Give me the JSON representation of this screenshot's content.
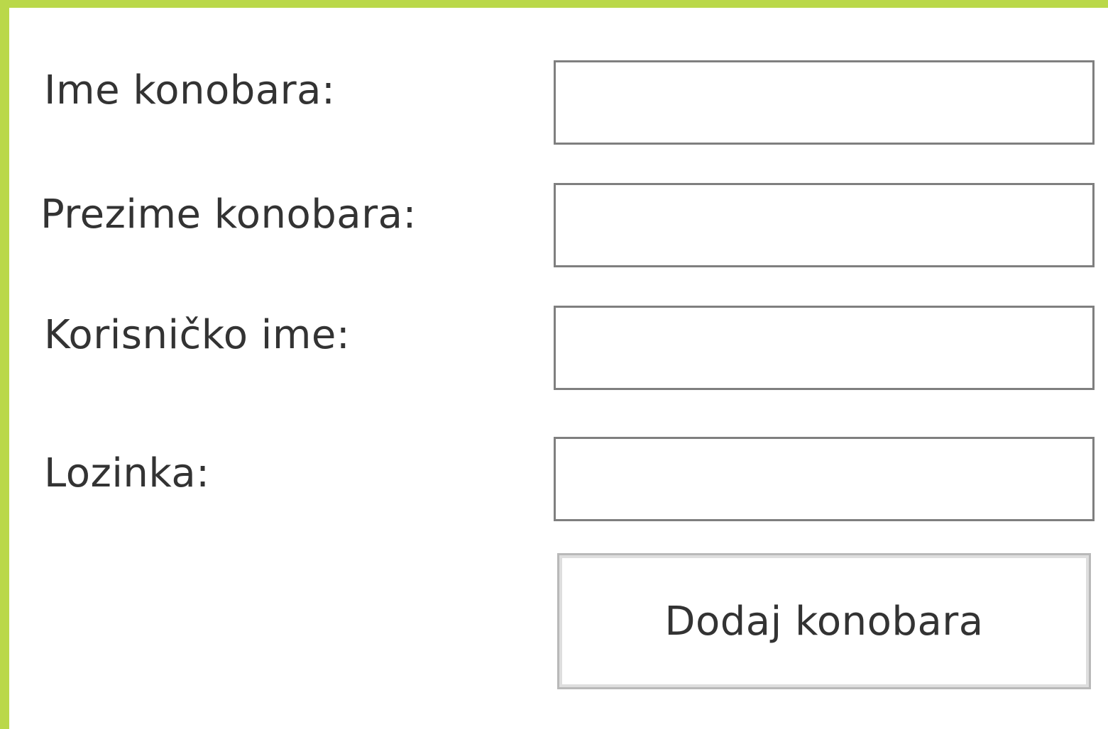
{
  "form": {
    "first_name": {
      "label": "Ime konobara:",
      "value": ""
    },
    "last_name": {
      "label": "Prezime konobara:",
      "value": ""
    },
    "username": {
      "label": "Korisničko ime:",
      "value": ""
    },
    "password": {
      "label": "Lozinka:",
      "value": ""
    },
    "submit_label": "Dodaj konobara"
  },
  "colors": {
    "frame_accent": "#bad84a",
    "field_border": "#7f7f7f",
    "button_border": "#b9b9b9",
    "text": "#333333"
  }
}
